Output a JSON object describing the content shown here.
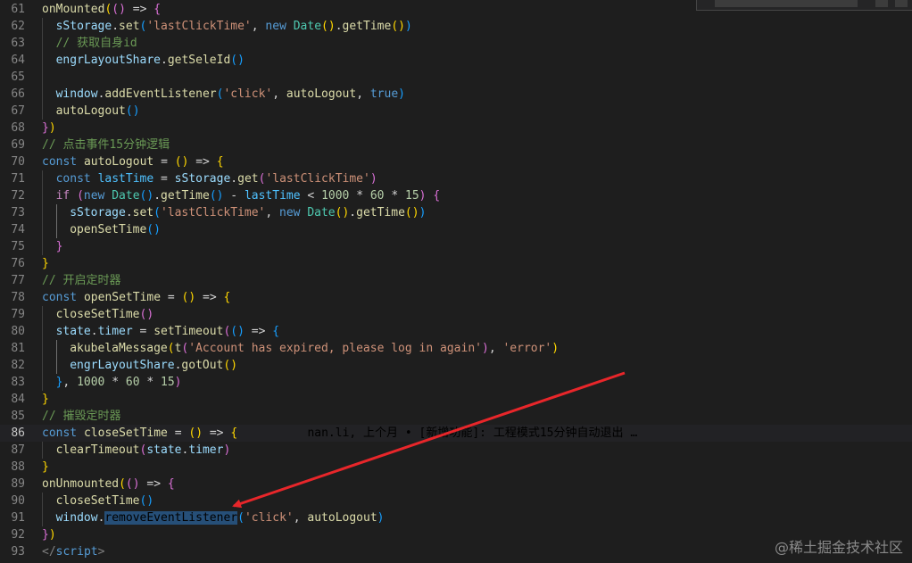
{
  "lines": [
    {
      "num": "61",
      "indent": 0,
      "tokens": [
        [
          "fn",
          "onMounted"
        ],
        [
          "b1",
          "("
        ],
        [
          "b2",
          "("
        ],
        [
          "b2",
          ")"
        ],
        [
          "op",
          " => "
        ],
        [
          "b2",
          "{"
        ]
      ]
    },
    {
      "num": "62",
      "indent": 1,
      "tokens": [
        [
          "var",
          "sStorage"
        ],
        [
          "pun",
          "."
        ],
        [
          "fn",
          "set"
        ],
        [
          "b3",
          "("
        ],
        [
          "str",
          "'lastClickTime'"
        ],
        [
          "pun",
          ", "
        ],
        [
          "kw",
          "new "
        ],
        [
          "cls",
          "Date"
        ],
        [
          "b1",
          "("
        ],
        [
          "b1",
          ")"
        ],
        [
          "pun",
          "."
        ],
        [
          "fn",
          "getTime"
        ],
        [
          "b1",
          "("
        ],
        [
          "b1",
          ")"
        ],
        [
          "b3",
          ")"
        ]
      ]
    },
    {
      "num": "63",
      "indent": 1,
      "tokens": [
        [
          "cmt",
          "// 获取自身id"
        ]
      ]
    },
    {
      "num": "64",
      "indent": 1,
      "tokens": [
        [
          "var",
          "engrLayoutShare"
        ],
        [
          "pun",
          "."
        ],
        [
          "fn",
          "getSeleId"
        ],
        [
          "b3",
          "("
        ],
        [
          "b3",
          ")"
        ]
      ]
    },
    {
      "num": "65",
      "indent": 1,
      "tokens": []
    },
    {
      "num": "66",
      "indent": 1,
      "tokens": [
        [
          "var",
          "window"
        ],
        [
          "pun",
          "."
        ],
        [
          "fn",
          "addEventListener"
        ],
        [
          "b3",
          "("
        ],
        [
          "str",
          "'click'"
        ],
        [
          "pun",
          ", "
        ],
        [
          "fn",
          "autoLogout"
        ],
        [
          "pun",
          ", "
        ],
        [
          "kw",
          "true"
        ],
        [
          "b3",
          ")"
        ]
      ]
    },
    {
      "num": "67",
      "indent": 1,
      "tokens": [
        [
          "fn",
          "autoLogout"
        ],
        [
          "b3",
          "("
        ],
        [
          "b3",
          ")"
        ]
      ]
    },
    {
      "num": "68",
      "indent": 0,
      "tokens": [
        [
          "b2",
          "}"
        ],
        [
          "b1",
          ")"
        ]
      ]
    },
    {
      "num": "69",
      "indent": 0,
      "tokens": [
        [
          "cmt",
          "// 点击事件15分钟逻辑"
        ]
      ]
    },
    {
      "num": "70",
      "indent": 0,
      "tokens": [
        [
          "kw",
          "const "
        ],
        [
          "fn",
          "autoLogout"
        ],
        [
          "op",
          " = "
        ],
        [
          "b1",
          "("
        ],
        [
          "b1",
          ")"
        ],
        [
          "op",
          " => "
        ],
        [
          "b1",
          "{"
        ]
      ]
    },
    {
      "num": "71",
      "indent": 1,
      "tokens": [
        [
          "kw",
          "const "
        ],
        [
          "const",
          "lastTime"
        ],
        [
          "op",
          " = "
        ],
        [
          "var",
          "sStorage"
        ],
        [
          "pun",
          "."
        ],
        [
          "fn",
          "get"
        ],
        [
          "b2",
          "("
        ],
        [
          "str",
          "'lastClickTime'"
        ],
        [
          "b2",
          ")"
        ]
      ]
    },
    {
      "num": "72",
      "indent": 1,
      "tokens": [
        [
          "ctrl",
          "if "
        ],
        [
          "b2",
          "("
        ],
        [
          "kw",
          "new "
        ],
        [
          "cls",
          "Date"
        ],
        [
          "b3",
          "("
        ],
        [
          "b3",
          ")"
        ],
        [
          "pun",
          "."
        ],
        [
          "fn",
          "getTime"
        ],
        [
          "b3",
          "("
        ],
        [
          "b3",
          ")"
        ],
        [
          "op",
          " - "
        ],
        [
          "const",
          "lastTime"
        ],
        [
          "op",
          " < "
        ],
        [
          "num",
          "1000"
        ],
        [
          "op",
          " * "
        ],
        [
          "num",
          "60"
        ],
        [
          "op",
          " * "
        ],
        [
          "num",
          "15"
        ],
        [
          "b2",
          ")"
        ],
        [
          "pun",
          " "
        ],
        [
          "b2",
          "{"
        ]
      ]
    },
    {
      "num": "73",
      "indent": 2,
      "tokens": [
        [
          "var",
          "sStorage"
        ],
        [
          "pun",
          "."
        ],
        [
          "fn",
          "set"
        ],
        [
          "b3",
          "("
        ],
        [
          "str",
          "'lastClickTime'"
        ],
        [
          "pun",
          ", "
        ],
        [
          "kw",
          "new "
        ],
        [
          "cls",
          "Date"
        ],
        [
          "b1",
          "("
        ],
        [
          "b1",
          ")"
        ],
        [
          "pun",
          "."
        ],
        [
          "fn",
          "getTime"
        ],
        [
          "b1",
          "("
        ],
        [
          "b1",
          ")"
        ],
        [
          "b3",
          ")"
        ]
      ]
    },
    {
      "num": "74",
      "indent": 2,
      "tokens": [
        [
          "fn",
          "openSetTime"
        ],
        [
          "b3",
          "("
        ],
        [
          "b3",
          ")"
        ]
      ]
    },
    {
      "num": "75",
      "indent": 1,
      "tokens": [
        [
          "b2",
          "}"
        ]
      ]
    },
    {
      "num": "76",
      "indent": 0,
      "tokens": [
        [
          "b1",
          "}"
        ]
      ]
    },
    {
      "num": "77",
      "indent": 0,
      "tokens": [
        [
          "cmt",
          "// 开启定时器"
        ]
      ]
    },
    {
      "num": "78",
      "indent": 0,
      "tokens": [
        [
          "kw",
          "const "
        ],
        [
          "fn",
          "openSetTime"
        ],
        [
          "op",
          " = "
        ],
        [
          "b1",
          "("
        ],
        [
          "b1",
          ")"
        ],
        [
          "op",
          " => "
        ],
        [
          "b1",
          "{"
        ]
      ]
    },
    {
      "num": "79",
      "indent": 1,
      "tokens": [
        [
          "fn",
          "closeSetTime"
        ],
        [
          "b2",
          "("
        ],
        [
          "b2",
          ")"
        ]
      ]
    },
    {
      "num": "80",
      "indent": 1,
      "tokens": [
        [
          "var",
          "state"
        ],
        [
          "pun",
          "."
        ],
        [
          "var",
          "timer"
        ],
        [
          "op",
          " = "
        ],
        [
          "fn",
          "setTimeout"
        ],
        [
          "b2",
          "("
        ],
        [
          "b3",
          "("
        ],
        [
          "b3",
          ")"
        ],
        [
          "op",
          " => "
        ],
        [
          "b3",
          "{"
        ]
      ]
    },
    {
      "num": "81",
      "indent": 2,
      "tokens": [
        [
          "fn",
          "akubelaMessage"
        ],
        [
          "b1",
          "("
        ],
        [
          "fn",
          "t"
        ],
        [
          "b2",
          "("
        ],
        [
          "str",
          "'Account has expired, please log in again'"
        ],
        [
          "b2",
          ")"
        ],
        [
          "pun",
          ", "
        ],
        [
          "str",
          "'error'"
        ],
        [
          "b1",
          ")"
        ]
      ]
    },
    {
      "num": "82",
      "indent": 2,
      "tokens": [
        [
          "var",
          "engrLayoutShare"
        ],
        [
          "pun",
          "."
        ],
        [
          "fn",
          "gotOut"
        ],
        [
          "b1",
          "("
        ],
        [
          "b1",
          ")"
        ]
      ]
    },
    {
      "num": "83",
      "indent": 1,
      "tokens": [
        [
          "b3",
          "}"
        ],
        [
          "pun",
          ", "
        ],
        [
          "num",
          "1000"
        ],
        [
          "op",
          " * "
        ],
        [
          "num",
          "60"
        ],
        [
          "op",
          " * "
        ],
        [
          "num",
          "15"
        ],
        [
          "b2",
          ")"
        ]
      ]
    },
    {
      "num": "84",
      "indent": 0,
      "tokens": [
        [
          "b1",
          "}"
        ]
      ]
    },
    {
      "num": "85",
      "indent": 0,
      "tokens": [
        [
          "cmt",
          "// 摧毁定时器"
        ]
      ]
    },
    {
      "num": "86",
      "indent": 0,
      "current": true,
      "tokens": [
        [
          "kw",
          "const "
        ],
        [
          "fn",
          "closeSetTime"
        ],
        [
          "op",
          " = "
        ],
        [
          "b1",
          "("
        ],
        [
          "b1",
          ")"
        ],
        [
          "op",
          " => "
        ],
        [
          "b1",
          "{"
        ],
        [
          "blame",
          "          nan.li, 上个月 • [新增功能]: 工程模式15分钟自动退出 …"
        ]
      ]
    },
    {
      "num": "87",
      "indent": 1,
      "tokens": [
        [
          "fn",
          "clearTimeout"
        ],
        [
          "b2",
          "("
        ],
        [
          "var",
          "state"
        ],
        [
          "pun",
          "."
        ],
        [
          "var",
          "timer"
        ],
        [
          "b2",
          ")"
        ]
      ]
    },
    {
      "num": "88",
      "indent": 0,
      "tokens": [
        [
          "b1",
          "}"
        ]
      ]
    },
    {
      "num": "89",
      "indent": 0,
      "tokens": [
        [
          "fn",
          "onUnmounted"
        ],
        [
          "b1",
          "("
        ],
        [
          "b2",
          "("
        ],
        [
          "b2",
          ")"
        ],
        [
          "op",
          " => "
        ],
        [
          "b2",
          "{"
        ]
      ]
    },
    {
      "num": "90",
      "indent": 1,
      "tokens": [
        [
          "fn",
          "closeSetTime"
        ],
        [
          "b3",
          "("
        ],
        [
          "b3",
          ")"
        ]
      ]
    },
    {
      "num": "91",
      "indent": 1,
      "tokens": [
        [
          "var",
          "window"
        ],
        [
          "pun",
          "."
        ],
        [
          "hl",
          "removeEventListener"
        ],
        [
          "b3",
          "("
        ],
        [
          "str",
          "'click'"
        ],
        [
          "pun",
          ", "
        ],
        [
          "fn",
          "autoLogout"
        ],
        [
          "b3",
          ")"
        ]
      ]
    },
    {
      "num": "92",
      "indent": 0,
      "tokens": [
        [
          "b2",
          "}"
        ],
        [
          "b1",
          ")"
        ]
      ]
    },
    {
      "num": "93",
      "indent": 0,
      "tokens": [
        [
          "tag",
          "</"
        ],
        [
          "tagname",
          "script"
        ],
        [
          "tag",
          ">"
        ]
      ]
    }
  ],
  "watermark": "@稀土掘金技术社区",
  "colors": {
    "background": "#1e1e1e",
    "arrow": "#e8262a",
    "selection": "#264f78"
  }
}
